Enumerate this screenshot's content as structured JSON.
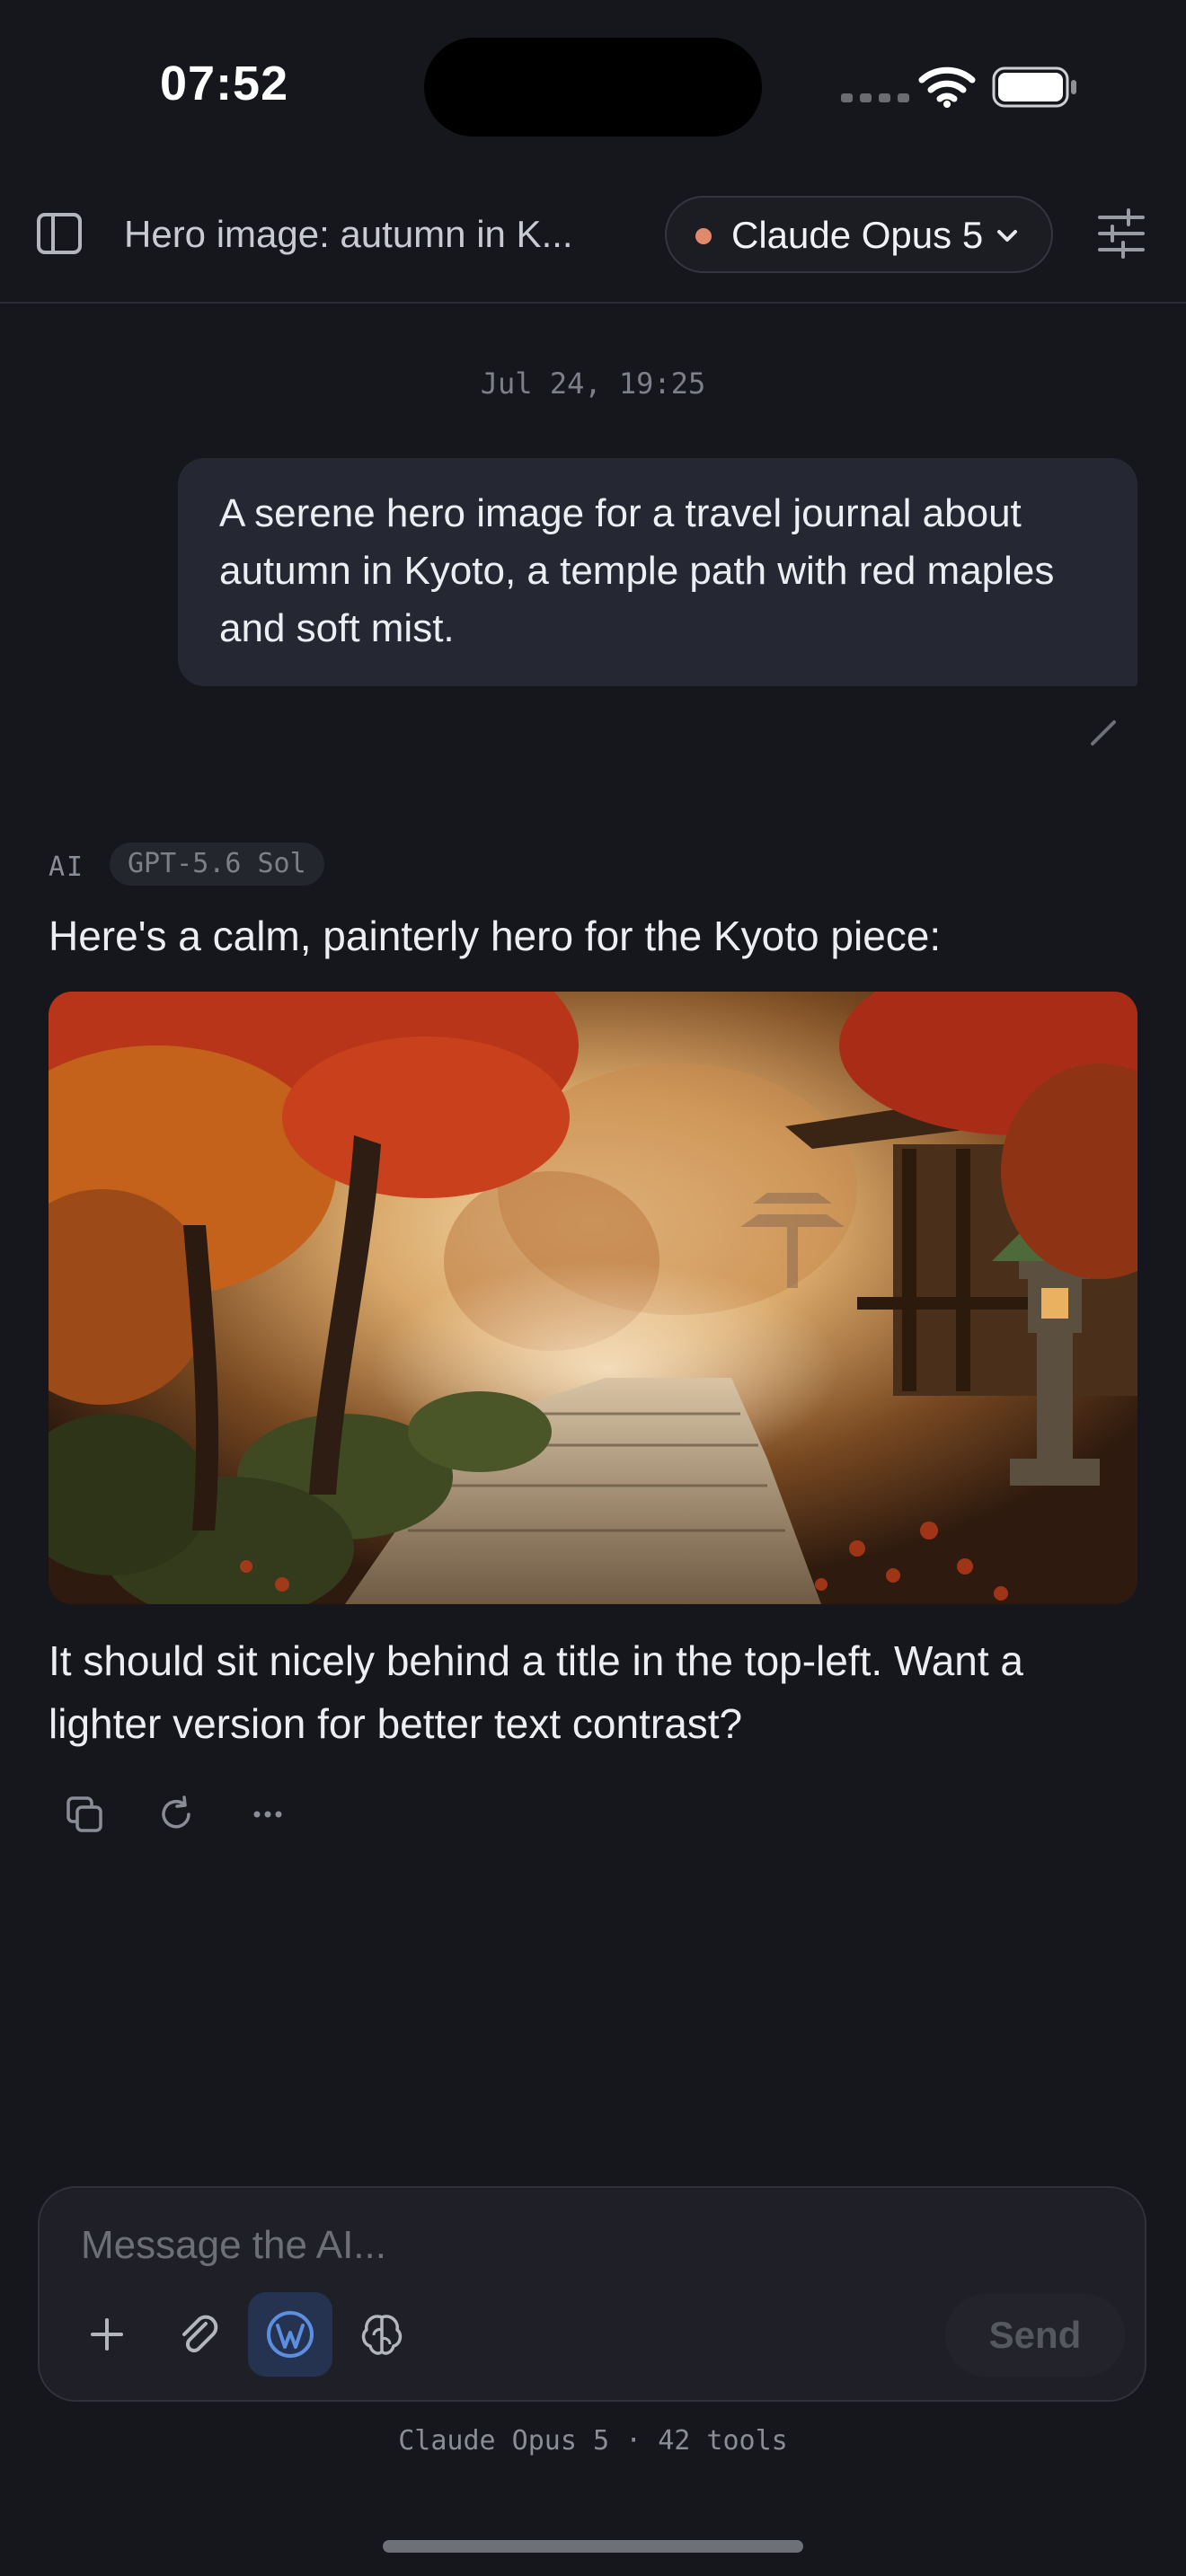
{
  "status_bar": {
    "time": "07:52"
  },
  "header": {
    "title": "Hero image: autumn in K...",
    "model": "Claude Opus 5"
  },
  "conversation": {
    "timestamp": "Jul 24, 19:25",
    "user_message": "A serene hero image for a travel journal about autumn in Kyoto, a temple path with red maples and soft mist.",
    "ai_label": "AI",
    "ai_model": "GPT-5.6 Sol",
    "ai_intro": "Here's a calm, painterly hero for the Kyoto piece:",
    "ai_followup": "It should sit nicely behind a title in the top-left. Want a lighter version for better text contrast?"
  },
  "composer": {
    "placeholder": "Message the AI...",
    "send_label": "Send"
  },
  "footer": {
    "note": "Claude Opus 5 · 42 tools"
  },
  "icons": {
    "sidebar": "sidebar-icon",
    "chevron": "chevron-down-icon",
    "settings": "sliders-icon",
    "edit": "pencil-icon",
    "copy": "copy-icon",
    "regenerate": "refresh-icon",
    "more": "more-icon",
    "add": "plus-icon",
    "attach": "paperclip-icon",
    "wordpress": "wordpress-icon",
    "brain": "brain-icon"
  },
  "colors": {
    "background": "#16171c",
    "model_dot": "#e08a6b",
    "user_bubble": "#252833",
    "active_tool": "#253350"
  }
}
